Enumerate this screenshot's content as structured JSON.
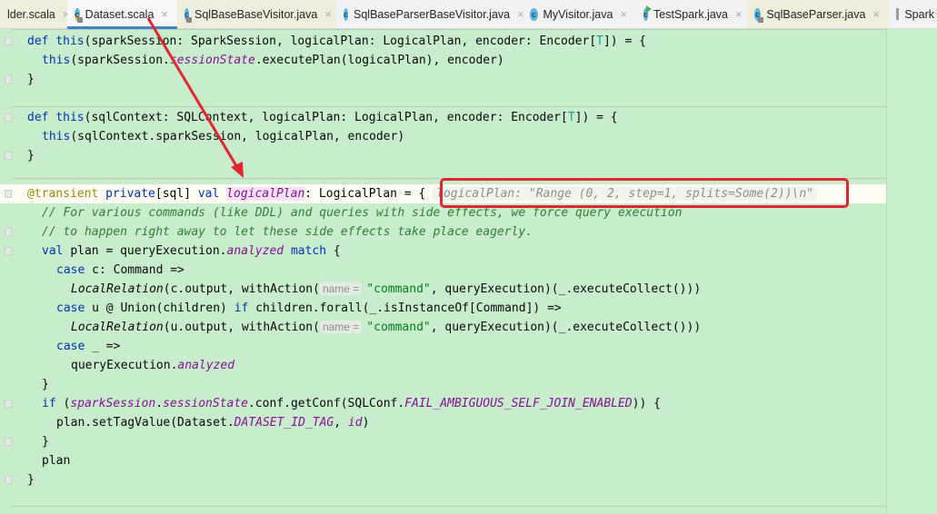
{
  "tabs": [
    {
      "label": "lder.scala",
      "icon": "none",
      "style": "beige"
    },
    {
      "label": "Dataset.scala",
      "icon": "scala-class-icon",
      "active": true
    },
    {
      "label": "SqlBaseBaseVisitor.java",
      "icon": "java-class-icon",
      "style": "beige"
    },
    {
      "label": "SqlBaseParserBaseVisitor.java",
      "icon": "java-class-icon"
    },
    {
      "label": "MyVisitor.java",
      "icon": "java-class-icon"
    },
    {
      "label": "TestSpark.java",
      "icon": "java-runnable-class-icon"
    },
    {
      "label": "SqlBaseParser.java",
      "icon": "java-class-icon",
      "style": "beige"
    },
    {
      "label": "Spark",
      "icon": "file-icon"
    }
  ],
  "colors": {
    "keyword": "#0033b3",
    "field": "#871094",
    "comment": "#2f7d32",
    "string": "#067d17",
    "annotation": "#9e880d",
    "highlight_box": "#e0262e",
    "arrow": "#e0262e",
    "diff_background": "#c7edcc"
  },
  "code": [
    {
      "indent": 0,
      "tokens": [
        [
          "def ",
          "k"
        ],
        [
          "this",
          "k"
        ],
        [
          "(sparkSession: SparkSession, logicalPlan: LogicalPlan, encoder: Encoder[",
          ""
        ],
        [
          "T",
          "t"
        ],
        [
          "]) = {",
          ""
        ]
      ]
    },
    {
      "indent": 1,
      "tokens": [
        [
          "this",
          "k"
        ],
        [
          "(sparkSession.",
          ""
        ],
        [
          "sessionState",
          "p"
        ],
        [
          ".executePlan(logicalPlan), encoder)",
          ""
        ]
      ]
    },
    {
      "indent": 0,
      "tokens": [
        [
          "}",
          ""
        ]
      ]
    },
    {
      "indent": 0,
      "tokens": []
    },
    {
      "indent": 0,
      "tokens": [
        [
          "def ",
          "k"
        ],
        [
          "this",
          "k"
        ],
        [
          "(sqlContext: SQLContext, logicalPlan: LogicalPlan, encoder: Encoder[",
          ""
        ],
        [
          "T",
          "t"
        ],
        [
          "]) = {",
          ""
        ]
      ]
    },
    {
      "indent": 1,
      "tokens": [
        [
          "this",
          "k"
        ],
        [
          "(sqlContext.sparkSession, logicalPlan, encoder)",
          ""
        ]
      ]
    },
    {
      "indent": 0,
      "tokens": [
        [
          "}",
          ""
        ]
      ]
    },
    {
      "indent": 0,
      "tokens": []
    },
    {
      "indent": 0,
      "highlight": true,
      "tokens": [
        [
          "@transient ",
          "a"
        ],
        [
          "private",
          "k"
        ],
        [
          "[sql] ",
          ""
        ],
        [
          "val ",
          "k"
        ],
        [
          "|",
          "caret"
        ],
        [
          "logicalPlan",
          "pv"
        ],
        [
          ": LogicalPlan = { ",
          ""
        ],
        [
          "logicalPlan: \"Range (0, 2, step=1, splits=Some(2))\\n\"",
          "hint"
        ]
      ]
    },
    {
      "indent": 1,
      "tokens": [
        [
          "// For various commands (like DDL) and queries with side effects, we force query execution",
          "c"
        ]
      ]
    },
    {
      "indent": 1,
      "tokens": [
        [
          "// to happen right away to let these side effects take place eagerly.",
          "c"
        ]
      ]
    },
    {
      "indent": 1,
      "tokens": [
        [
          "val ",
          "k"
        ],
        [
          "plan = queryExecution.",
          ""
        ],
        [
          "analyzed",
          "p"
        ],
        [
          " match",
          "k"
        ],
        [
          " {",
          ""
        ]
      ]
    },
    {
      "indent": 2,
      "tokens": [
        [
          "case ",
          "k"
        ],
        [
          "c: Command =>",
          ""
        ]
      ]
    },
    {
      "indent": 3,
      "tokens": [
        [
          "LocalRelation",
          "i"
        ],
        [
          "(c.output, withAction(",
          ""
        ],
        [
          "name =",
          "hn"
        ],
        [
          "\"command\"",
          "s"
        ],
        [
          ", queryExecution)(_.executeCollect()))",
          ""
        ]
      ]
    },
    {
      "indent": 2,
      "tokens": [
        [
          "case ",
          "k"
        ],
        [
          "u @ Union(children) ",
          ""
        ],
        [
          "if",
          "k"
        ],
        [
          " children.forall(_.isInstanceOf[Command]) =>",
          ""
        ]
      ]
    },
    {
      "indent": 3,
      "tokens": [
        [
          "LocalRelation",
          "i"
        ],
        [
          "(u.output, withAction(",
          ""
        ],
        [
          "name =",
          "hn"
        ],
        [
          "\"command\"",
          "s"
        ],
        [
          ", queryExecution)(_.executeCollect()))",
          ""
        ]
      ]
    },
    {
      "indent": 2,
      "tokens": [
        [
          "case ",
          "k"
        ],
        [
          "_ =>",
          ""
        ]
      ]
    },
    {
      "indent": 3,
      "tokens": [
        [
          "queryExecution.",
          ""
        ],
        [
          "analyzed",
          "p"
        ]
      ]
    },
    {
      "indent": 1,
      "tokens": [
        [
          "}",
          ""
        ]
      ]
    },
    {
      "indent": 1,
      "tokens": [
        [
          "if",
          "k"
        ],
        [
          " (",
          ""
        ],
        [
          "sparkSession",
          "p"
        ],
        [
          ".",
          ""
        ],
        [
          "sessionState",
          "p"
        ],
        [
          ".conf.getConf(SQLConf.",
          ""
        ],
        [
          "FAIL_AMBIGUOUS_SELF_JOIN_ENABLED",
          "p"
        ],
        [
          ")) {",
          ""
        ]
      ]
    },
    {
      "indent": 2,
      "tokens": [
        [
          "plan.setTagValue(Dataset.",
          ""
        ],
        [
          "DATASET_ID_TAG",
          "p"
        ],
        [
          ", ",
          ""
        ],
        [
          "id",
          "p"
        ],
        [
          ")",
          ""
        ]
      ]
    },
    {
      "indent": 1,
      "tokens": [
        [
          "}",
          ""
        ]
      ]
    },
    {
      "indent": 1,
      "tokens": [
        [
          "plan",
          ""
        ]
      ]
    },
    {
      "indent": 0,
      "tokens": [
        [
          "}",
          ""
        ]
      ]
    }
  ]
}
